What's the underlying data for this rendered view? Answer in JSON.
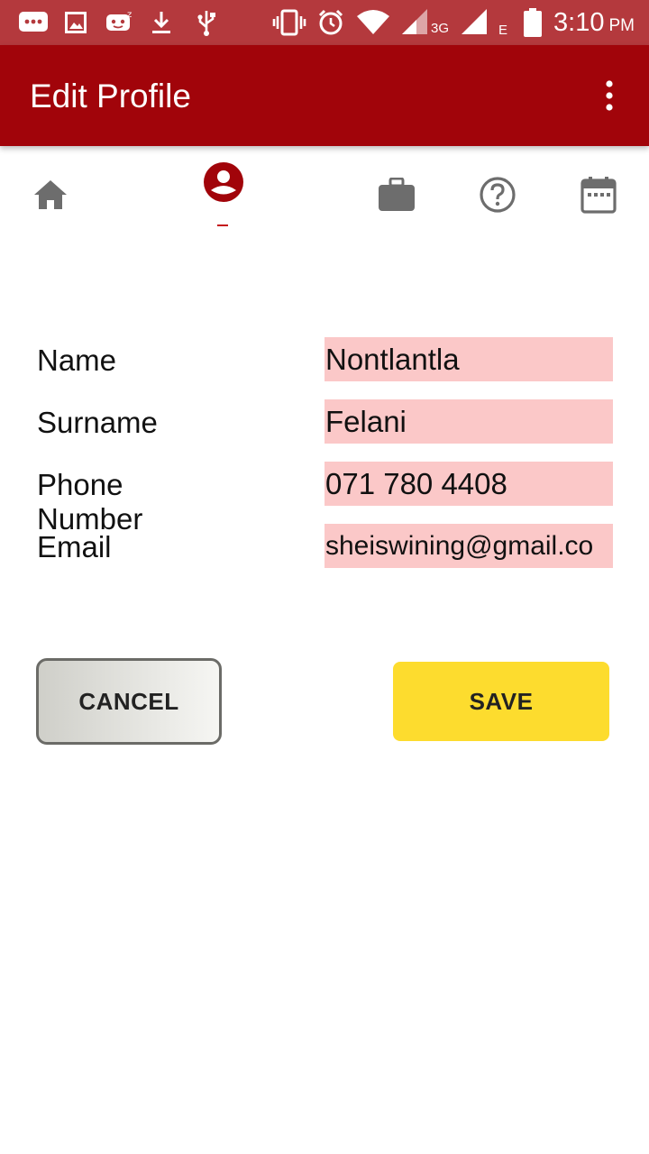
{
  "status_bar": {
    "time": "3:10",
    "ampm": "PM",
    "network_1": "3G",
    "network_2": "E",
    "icons": [
      "message-icon",
      "image-icon",
      "notification-app-icon",
      "download-icon",
      "usb-icon",
      "vibrate-icon",
      "alarm-icon",
      "wifi-icon",
      "signal-icon",
      "signal-icon",
      "battery-icon"
    ]
  },
  "app_bar": {
    "title": "Edit Profile",
    "overflow_icon": "more-vert-icon"
  },
  "nav": {
    "items": [
      {
        "icon": "home-icon",
        "active": false
      },
      {
        "icon": "account-circle-icon",
        "active": true
      },
      {
        "icon": "briefcase-icon",
        "active": false
      },
      {
        "icon": "help-icon",
        "active": false
      },
      {
        "icon": "calendar-icon",
        "active": false
      }
    ]
  },
  "form": {
    "name_label": "Name",
    "name_value": "Nontlantla",
    "surname_label": "Surname",
    "surname_value": "Felani",
    "phone_label": "Phone Number",
    "phone_value": "071 780 4408",
    "email_label": "Email",
    "email_value": "sheiswining@gmail.co"
  },
  "actions": {
    "cancel_label": "CANCEL",
    "save_label": "SAVE"
  },
  "colors": {
    "status_bar": "#b4393d",
    "app_bar": "#a1040a",
    "accent": "#c4161c",
    "field_bg": "#fbc8c8",
    "save_bg": "#fddc2e",
    "icon_gray": "#6d6d6d"
  }
}
